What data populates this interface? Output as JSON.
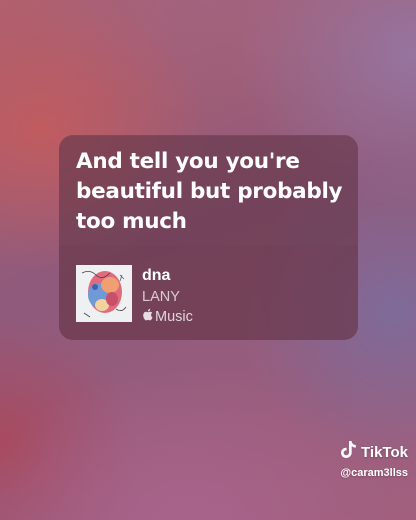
{
  "lyric_card": {
    "lyric_lines": [
      "And tell you you're",
      "beautiful but probably",
      "too much"
    ],
    "song": {
      "title": "dna",
      "artist": "LANY",
      "service": "Music",
      "service_icon": "apple-icon"
    }
  },
  "watermark": {
    "brand": "TikTok",
    "brand_icon": "tiktok-logo-icon",
    "handle": "@caram3llss"
  }
}
